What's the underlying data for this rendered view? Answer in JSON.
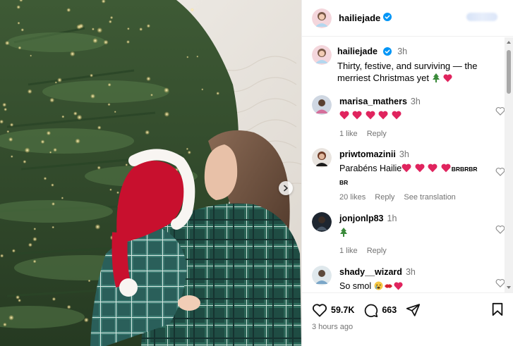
{
  "post": {
    "username": "hailiejade",
    "verified": true,
    "caption_username": "hailiejade",
    "caption_time": "3h",
    "caption_text": "Thirty, festive, and surviving — the merriest Christmas yet",
    "caption_emoji": [
      "christmas-tree",
      "red-heart"
    ]
  },
  "comments": [
    {
      "username": "marisa_mathers",
      "time": "3h",
      "text": "",
      "emoji": [
        "red-heart",
        "red-heart",
        "red-heart",
        "red-heart",
        "red-heart"
      ],
      "likes": "1 like",
      "reply": "Reply",
      "translate": ""
    },
    {
      "username": "priwtomazinii",
      "time": "3h",
      "text": "Parabéns Hailie",
      "suffix": "BRBRBR",
      "suffix2": "BR",
      "emoji": [
        "red-heart",
        "red-heart",
        "red-heart",
        "red-heart"
      ],
      "likes": "20 likes",
      "reply": "Reply",
      "translate": "See translation"
    },
    {
      "username": "jonjonlp83",
      "time": "1h",
      "text": "",
      "emoji": [
        "christmas-tree"
      ],
      "likes": "1 like",
      "reply": "Reply",
      "translate": ""
    },
    {
      "username": "shady__wizard",
      "time": "3h",
      "text": "So smol",
      "emoji": [
        "crying-face",
        "lips",
        "red-heart"
      ],
      "likes": "",
      "reply": "",
      "translate": ""
    }
  ],
  "actions": {
    "likes_count": "59.7K",
    "comments_count": "663",
    "post_time": "3 hours ago"
  },
  "colors": {
    "verified_blue": "#0095f6",
    "heart_red": "#e0245e",
    "muted": "#737373"
  },
  "icons": [
    "heart-icon",
    "comment-icon",
    "share-icon",
    "save-icon",
    "next-arrow-icon",
    "verified-badge-icon"
  ]
}
